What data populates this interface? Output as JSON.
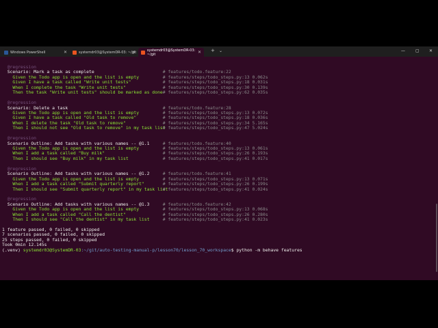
{
  "tabs": [
    {
      "label": "Windows PowerShell",
      "active": false
    },
    {
      "label": "systemdr03@SystemDR-03: ~/git",
      "active": false
    },
    {
      "label": "systemdr03@SystemDR-03: ~/git",
      "active": true
    }
  ],
  "terminal": {
    "scenarios": [
      {
        "tag": "@regression",
        "title": "Scenario: Mark a task as complete",
        "title_ref": "# features/todo.feature:22",
        "steps": [
          {
            "text": "Given the Todo app is open and the list is empty",
            "ref": "# features/steps/todo_steps.py:13 0.062s"
          },
          {
            "text": "Given I have a task called \"Write unit tests\"",
            "ref": "# features/steps/todo_steps.py:18 0.031s"
          },
          {
            "text": "When I complete the task \"Write unit tests\"",
            "ref": "# features/steps/todo_steps.py:30 0.139s"
          },
          {
            "text": "Then the task \"Write unit tests\" should be marked as done",
            "ref": "# features/steps/todo_steps.py:62 0.035s"
          }
        ]
      },
      {
        "tag": "@regression",
        "title": "Scenario: Delete a task",
        "title_ref": "# features/todo.feature:28",
        "steps": [
          {
            "text": "Given the Todo app is open and the list is empty",
            "ref": "# features/steps/todo_steps.py:13 0.072s"
          },
          {
            "text": "Given I have a task called \"Old task to remove\"",
            "ref": "# features/steps/todo_steps.py:18 0.036s"
          },
          {
            "text": "When I delete the task \"Old task to remove\"",
            "ref": "# features/steps/todo_steps.py:34 5.165s"
          },
          {
            "text": "Then I should not see \"Old task to remove\" in my task list",
            "ref": "# features/steps/todo_steps.py:47 5.024s"
          }
        ]
      },
      {
        "tag": "@regression",
        "title": "Scenario Outline: Add tasks with various names -- @1.1",
        "title_ref": "# features/todo.feature:40",
        "steps": [
          {
            "text": "Given the Todo app is open and the list is empty",
            "ref": "# features/steps/todo_steps.py:13 0.061s"
          },
          {
            "text": "When I add a task called \"Buy milk\"",
            "ref": "# features/steps/todo_steps.py:26 0.193s"
          },
          {
            "text": "Then I should see \"Buy milk\" in my task list",
            "ref": "# features/steps/todo_steps.py:41 0.017s"
          }
        ]
      },
      {
        "tag": "@regression",
        "title": "Scenario Outline: Add tasks with various names -- @1.2",
        "title_ref": "# features/todo.feature:41",
        "steps": [
          {
            "text": "Given the Todo app is open and the list is empty",
            "ref": "# features/steps/todo_steps.py:13 0.071s"
          },
          {
            "text": "When I add a task called \"Submit quarterly report\"",
            "ref": "# features/steps/todo_steps.py:26 0.199s"
          },
          {
            "text": "Then I should see \"Submit quarterly report\" in my task list",
            "ref": "# features/steps/todo_steps.py:41 0.024s"
          }
        ]
      },
      {
        "tag": "@regression",
        "title": "Scenario Outline: Add tasks with various names -- @1.3",
        "title_ref": "# features/todo.feature:42",
        "steps": [
          {
            "text": "Given the Todo app is open and the list is empty",
            "ref": "# features/steps/todo_steps.py:13 0.068s"
          },
          {
            "text": "When I add a task called \"Call the dentist\"",
            "ref": "# features/steps/todo_steps.py:26 0.280s"
          },
          {
            "text": "Then I should see \"Call the dentist\" in my task list",
            "ref": "# features/steps/todo_steps.py:41 0.023s"
          }
        ]
      }
    ],
    "summary": [
      "1 feature passed, 0 failed, 0 skipped",
      "7 scenarios passed, 0 failed, 0 skipped",
      "25 steps passed, 0 failed, 0 skipped",
      "Took 0min 12.145s"
    ],
    "prompt": {
      "venv": "(.venv)",
      "user": "systemdr03@SystemDR-03",
      "path": ":~/git/auto-testing-manual-p/lesson70/lesson_70_workspace",
      "symbol": "$",
      "command": "python -m behave features"
    }
  },
  "colors": {
    "background": "#300a24",
    "step_passed": "#8ae234",
    "comment": "#06989a",
    "tabbar": "#1f1f1f"
  }
}
